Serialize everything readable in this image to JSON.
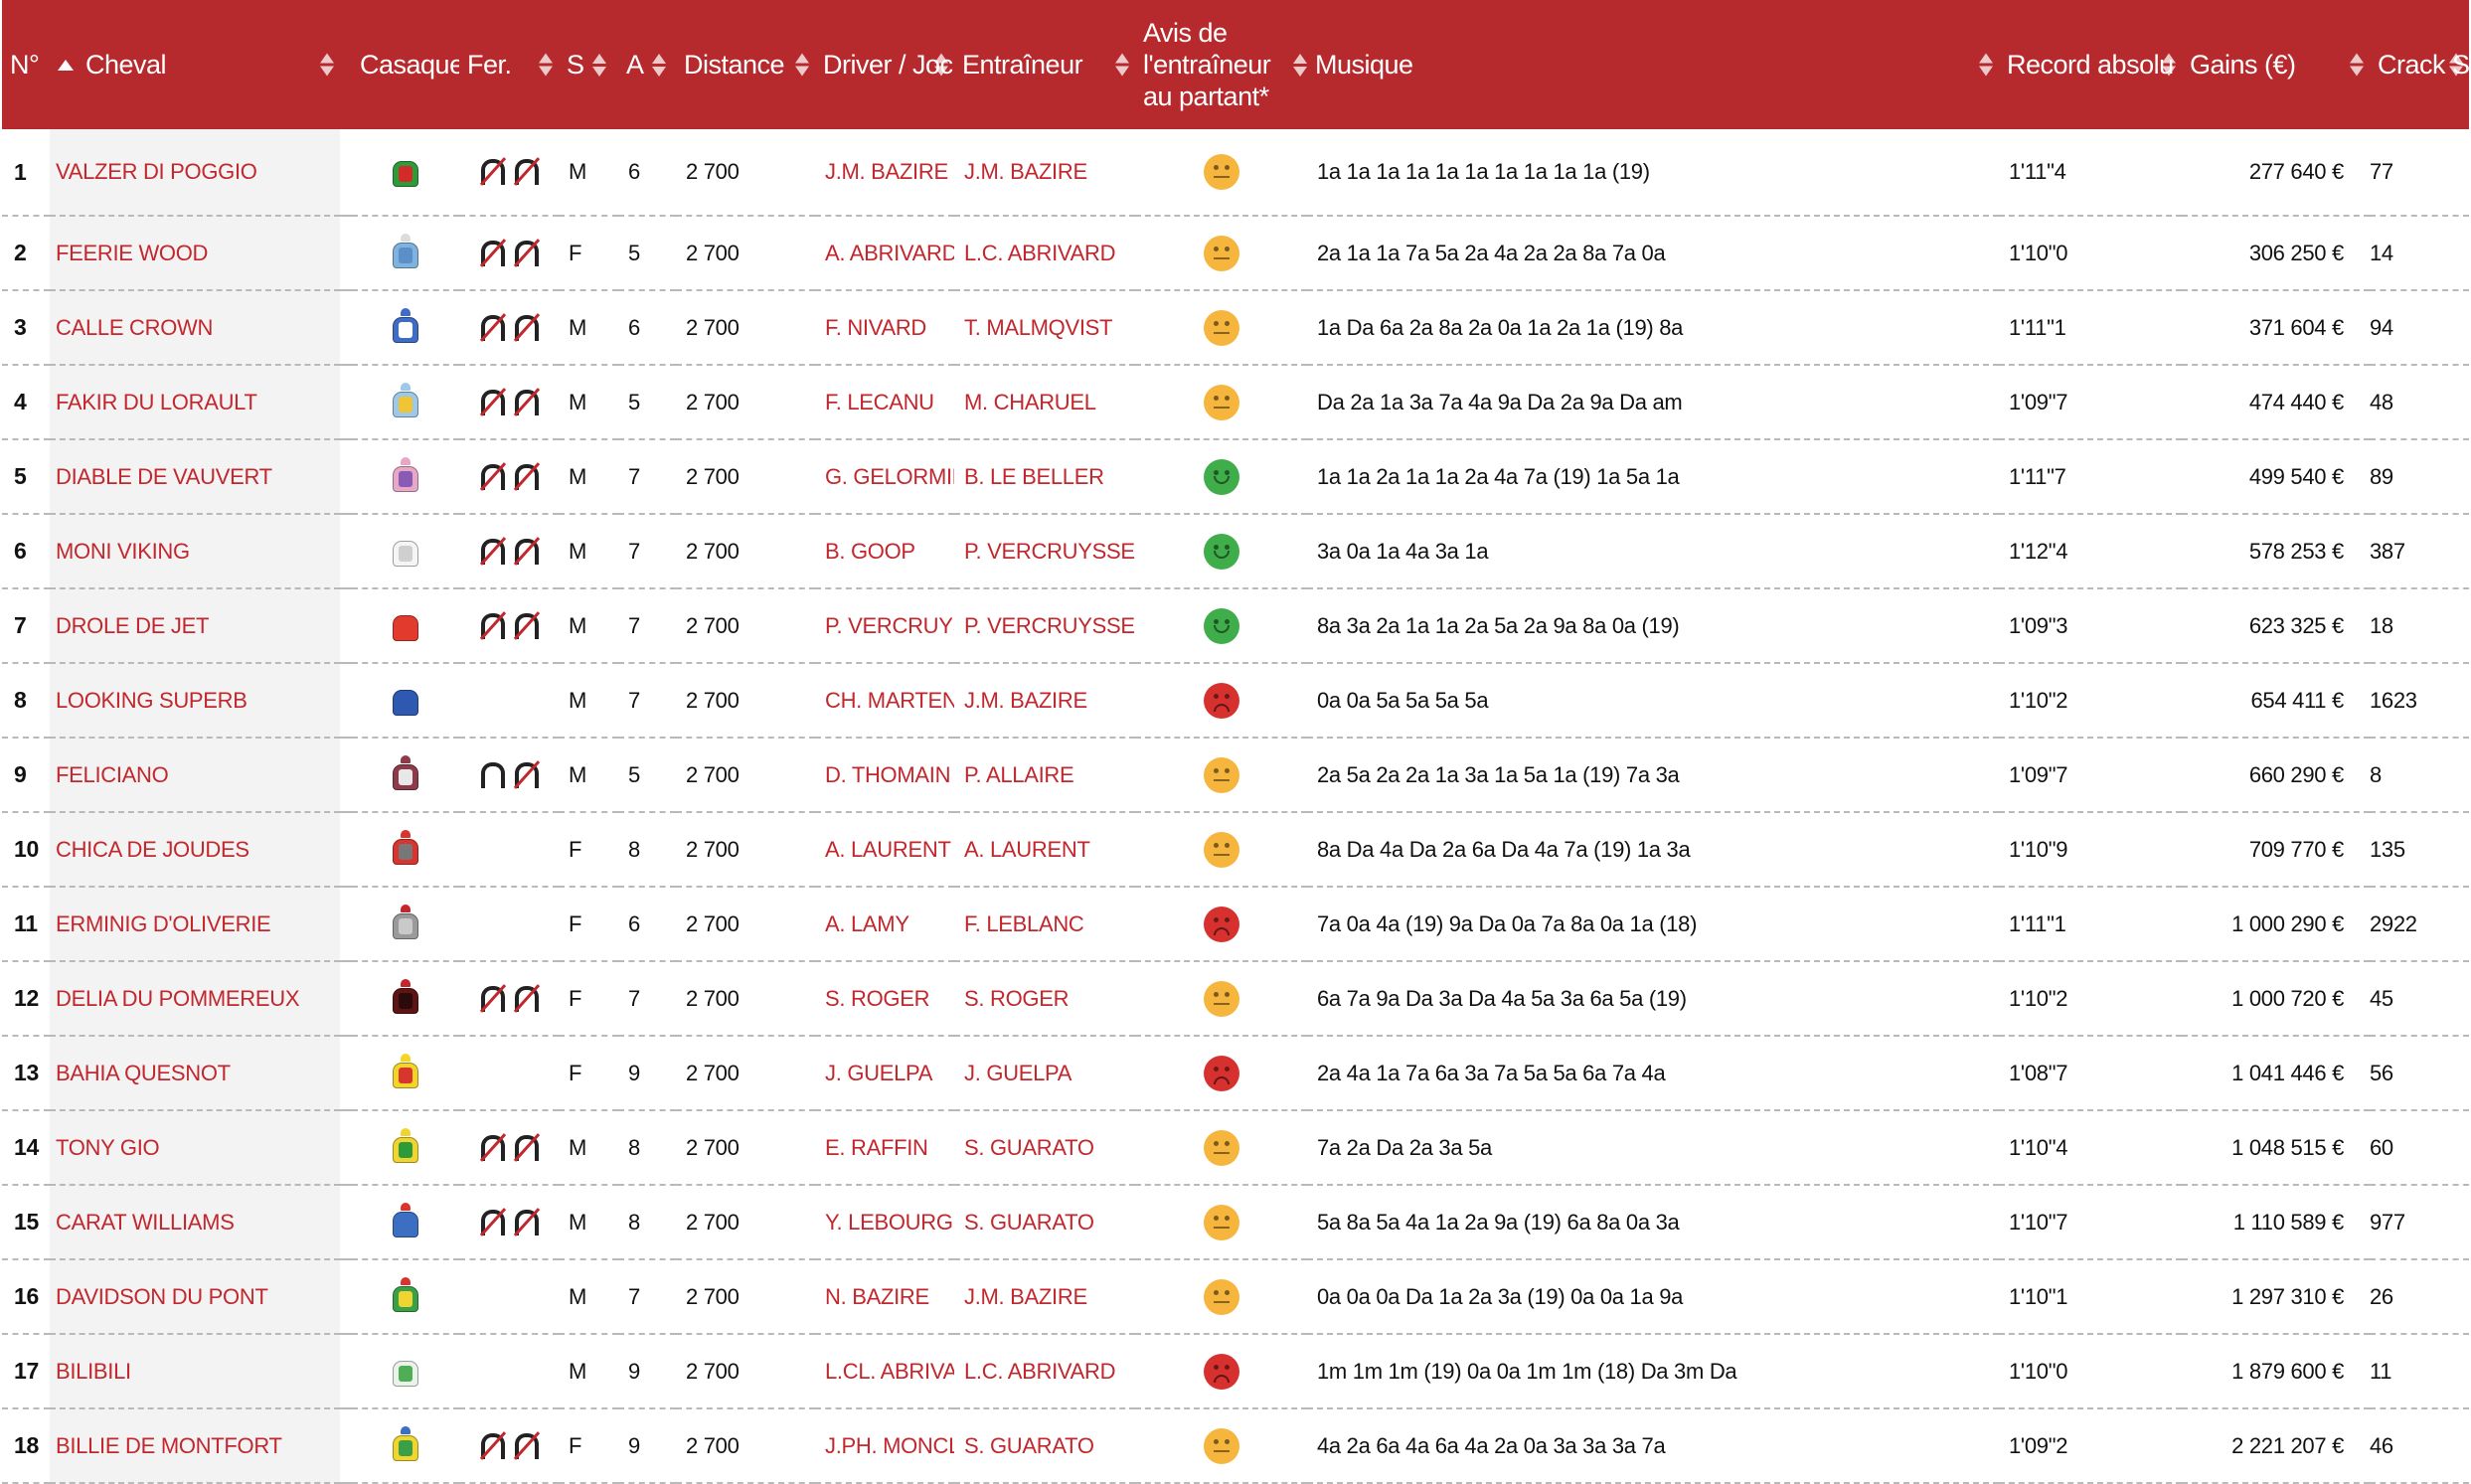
{
  "table": {
    "headers": {
      "num": "N°",
      "horse": "Cheval",
      "silk": "Casaque",
      "shoeing": "Fer.",
      "sex": "S",
      "age": "A",
      "distance": "Distance",
      "driver": "Driver / Jockey",
      "trainer": "Entraîneur",
      "opinion": "Avis de l'entraîneur au partant*",
      "music": "Musique",
      "record": "Record absolu",
      "earnings": "Gains (€)",
      "crack": "Crack Series"
    },
    "sort": {
      "column": "horse",
      "direction": "ascending"
    },
    "rows": [
      {
        "num": "1",
        "horse": "VALZER DI POGGIO",
        "silk": [
          "#2e9b3a",
          "#d32a2a",
          "#ffffff"
        ],
        "shoeing": "unshod-all",
        "sex": "M",
        "age": "6",
        "distance": "2 700",
        "driver": "J.M. BAZIRE",
        "trainer": "J.M. BAZIRE",
        "opinion": "neutral",
        "music": "1a 1a 1a 1a 1a 1a 1a 1a 1a 1a (19)",
        "record": "1'11\"4",
        "earnings": "277 640 €",
        "crack": "77"
      },
      {
        "num": "2",
        "horse": "FEERIE WOOD",
        "silk": [
          "#7fb2de",
          "#5a8fc7",
          "#dcdcdc"
        ],
        "shoeing": "unshod-all",
        "sex": "F",
        "age": "5",
        "distance": "2 700",
        "driver": "A. ABRIVARD",
        "trainer": "L.C. ABRIVARD",
        "opinion": "neutral",
        "music": "2a 1a 1a 7a 5a 2a 4a 2a 2a 8a 7a 0a",
        "record": "1'10\"0",
        "earnings": "306 250 €",
        "crack": "14"
      },
      {
        "num": "3",
        "horse": "CALLE CROWN",
        "silk": [
          "#3f6cc4",
          "#ffffff",
          "#3f6cc4"
        ],
        "shoeing": "unshod-all",
        "sex": "M",
        "age": "6",
        "distance": "2 700",
        "driver": "F. NIVARD",
        "trainer": "T. MALMQVIST",
        "opinion": "neutral",
        "music": "1a Da 6a 2a 8a 2a 0a 1a 2a 1a (19) 8a",
        "record": "1'11\"1",
        "earnings": "371 604 €",
        "crack": "94"
      },
      {
        "num": "4",
        "horse": "FAKIR DU LORAULT",
        "silk": [
          "#9cc8ec",
          "#f0c432",
          "#9cc8ec"
        ],
        "shoeing": "unshod-all",
        "sex": "M",
        "age": "5",
        "distance": "2 700",
        "driver": "F. LECANU",
        "trainer": "M. CHARUEL",
        "opinion": "neutral",
        "music": "Da 2a 1a 3a 7a 4a 9a Da 2a 9a Da am",
        "record": "1'09\"7",
        "earnings": "474 440 €",
        "crack": "48"
      },
      {
        "num": "5",
        "horse": "DIABLE DE VAUVERT",
        "silk": [
          "#e7a8c8",
          "#8a5bb5",
          "#e7a8c8"
        ],
        "shoeing": "unshod-all",
        "sex": "M",
        "age": "7",
        "distance": "2 700",
        "driver": "G. GELORMINI",
        "trainer": "B. LE BELLER",
        "opinion": "happy",
        "music": "1a 1a 2a 1a 1a 2a 4a 7a (19) 1a 5a 1a",
        "record": "1'11\"7",
        "earnings": "499 540 €",
        "crack": "89"
      },
      {
        "num": "6",
        "horse": "MONI VIKING",
        "silk": [
          "#f5f5f5",
          "#cfcfcf",
          "#ffffff"
        ],
        "shoeing": "unshod-all",
        "sex": "M",
        "age": "7",
        "distance": "2 700",
        "driver": "B. GOOP",
        "trainer": "P. VERCRUYSSE",
        "opinion": "happy",
        "music": "3a 0a 1a 4a 3a 1a",
        "record": "1'12\"4",
        "earnings": "578 253 €",
        "crack": "387"
      },
      {
        "num": "7",
        "horse": "DROLE DE JET",
        "silk": [
          "#e23b2e",
          "#e23b2e",
          "#ffffff"
        ],
        "shoeing": "unshod-all",
        "sex": "M",
        "age": "7",
        "distance": "2 700",
        "driver": "P. VERCRUYSSE",
        "trainer": "P. VERCRUYSSE",
        "opinion": "happy",
        "music": "8a 3a 2a 1a 1a 2a 5a 2a 9a 8a 0a (19)",
        "record": "1'09\"3",
        "earnings": "623 325 €",
        "crack": "18"
      },
      {
        "num": "8",
        "horse": "LOOKING SUPERB",
        "silk": [
          "#2f59b0",
          "#2f59b0",
          "#ffffff"
        ],
        "shoeing": "none",
        "sex": "M",
        "age": "7",
        "distance": "2 700",
        "driver": "CH. MARTENS",
        "trainer": "J.M. BAZIRE",
        "opinion": "sad",
        "music": "0a 0a 5a 5a 5a 5a",
        "record": "1'10\"2",
        "earnings": "654 411 €",
        "crack": "1623"
      },
      {
        "num": "9",
        "horse": "FELICIANO",
        "silk": [
          "#8d3b4a",
          "#e8e8e8",
          "#8d3b4a"
        ],
        "shoeing": "unshod-hind",
        "sex": "M",
        "age": "5",
        "distance": "2 700",
        "driver": "D. THOMAIN",
        "trainer": "P. ALLAIRE",
        "opinion": "neutral",
        "music": "2a 5a 2a 2a 1a 3a 1a 5a 1a (19) 7a 3a",
        "record": "1'09\"7",
        "earnings": "660 290 €",
        "crack": "8"
      },
      {
        "num": "10",
        "horse": "CHICA DE JOUDES",
        "silk": [
          "#d8352e",
          "#777777",
          "#d8352e"
        ],
        "shoeing": "none",
        "sex": "F",
        "age": "8",
        "distance": "2 700",
        "driver": "A. LAURENT",
        "trainer": "A. LAURENT",
        "opinion": "neutral",
        "music": "8a Da 4a Da 2a 6a Da 4a 7a (19) 1a 3a",
        "record": "1'10\"9",
        "earnings": "709 770 €",
        "crack": "135"
      },
      {
        "num": "11",
        "horse": "ERMINIG D'OLIVERIE",
        "silk": [
          "#9a9a9a",
          "#c9c9c9",
          "#c1272d"
        ],
        "shoeing": "none",
        "sex": "F",
        "age": "6",
        "distance": "2 700",
        "driver": "A. LAMY",
        "trainer": "F. LEBLANC",
        "opinion": "sad",
        "music": "7a 0a 4a (19) 9a Da 0a 7a 8a 0a 1a (18)",
        "record": "1'11\"1",
        "earnings": "1 000 290 €",
        "crack": "2922"
      },
      {
        "num": "12",
        "horse": "DELIA DU POMMEREUX",
        "silk": [
          "#5c1414",
          "#2a0a0a",
          "#c1272d"
        ],
        "shoeing": "unshod-all",
        "sex": "F",
        "age": "7",
        "distance": "2 700",
        "driver": "S. ROGER",
        "trainer": "S. ROGER",
        "opinion": "neutral",
        "music": "6a 7a 9a Da 3a Da 4a 5a 3a 6a 5a (19)",
        "record": "1'10\"2",
        "earnings": "1 000 720 €",
        "crack": "45"
      },
      {
        "num": "13",
        "horse": "BAHIA QUESNOT",
        "silk": [
          "#f3d52a",
          "#d8352e",
          "#f3d52a"
        ],
        "shoeing": "none",
        "sex": "F",
        "age": "9",
        "distance": "2 700",
        "driver": "J. GUELPA",
        "trainer": "J. GUELPA",
        "opinion": "sad",
        "music": "2a 4a 1a 7a 6a 3a 7a 5a 5a 6a 7a 4a",
        "record": "1'08\"7",
        "earnings": "1 041 446 €",
        "crack": "56"
      },
      {
        "num": "14",
        "horse": "TONY GIO",
        "silk": [
          "#f0d531",
          "#2e9b3a",
          "#f0d531"
        ],
        "shoeing": "unshod-all",
        "sex": "M",
        "age": "8",
        "distance": "2 700",
        "driver": "E. RAFFIN",
        "trainer": "S. GUARATO",
        "opinion": "neutral",
        "music": "7a 2a Da 2a 3a 5a",
        "record": "1'10\"4",
        "earnings": "1 048 515 €",
        "crack": "60"
      },
      {
        "num": "15",
        "horse": "CARAT WILLIAMS",
        "silk": [
          "#3c6fc2",
          "#3c6fc2",
          "#d8352e"
        ],
        "shoeing": "unshod-all",
        "sex": "M",
        "age": "8",
        "distance": "2 700",
        "driver": "Y. LEBOURGEOIS",
        "trainer": "S. GUARATO",
        "opinion": "neutral",
        "music": "5a 8a 5a 4a 1a 2a 9a (19) 6a 8a 0a 3a",
        "record": "1'10\"7",
        "earnings": "1 110 589 €",
        "crack": "977"
      },
      {
        "num": "16",
        "horse": "DAVIDSON DU PONT",
        "silk": [
          "#3aa048",
          "#f0d531",
          "#d8352e"
        ],
        "shoeing": "none",
        "sex": "M",
        "age": "7",
        "distance": "2 700",
        "driver": "N. BAZIRE",
        "trainer": "J.M. BAZIRE",
        "opinion": "neutral",
        "music": "0a 0a 0a Da 1a 2a 3a (19) 0a 0a 1a 9a",
        "record": "1'10\"1",
        "earnings": "1 297 310 €",
        "crack": "26"
      },
      {
        "num": "17",
        "horse": "BILIBILI",
        "silk": [
          "#e9f3e9",
          "#4fae55",
          "#ffffff"
        ],
        "shoeing": "none",
        "sex": "M",
        "age": "9",
        "distance": "2 700",
        "driver": "L.CL. ABRIVARD",
        "trainer": "L.C. ABRIVARD",
        "opinion": "sad",
        "music": "1m 1m 1m (19) 0a 0a 1m 1m (18) Da 3m Da",
        "record": "1'10\"0",
        "earnings": "1 879 600 €",
        "crack": "11"
      },
      {
        "num": "18",
        "horse": "BILLIE DE MONTFORT",
        "silk": [
          "#f0d531",
          "#3aa048",
          "#3a6fc2"
        ],
        "shoeing": "unshod-all",
        "sex": "F",
        "age": "9",
        "distance": "2 700",
        "driver": "J.PH. MONCLIN",
        "trainer": "S. GUARATO",
        "opinion": "neutral",
        "music": "4a 2a 6a 4a 6a 4a 2a 0a 3a 3a 3a 7a",
        "record": "1'09\"2",
        "earnings": "2 221 207 €",
        "crack": "46"
      }
    ]
  },
  "colors": {
    "header_bg": "#b6292d",
    "accent_text": "#c1272d",
    "happy": "#3fad4a",
    "neutral": "#f6b53c",
    "sad": "#d7312f"
  }
}
